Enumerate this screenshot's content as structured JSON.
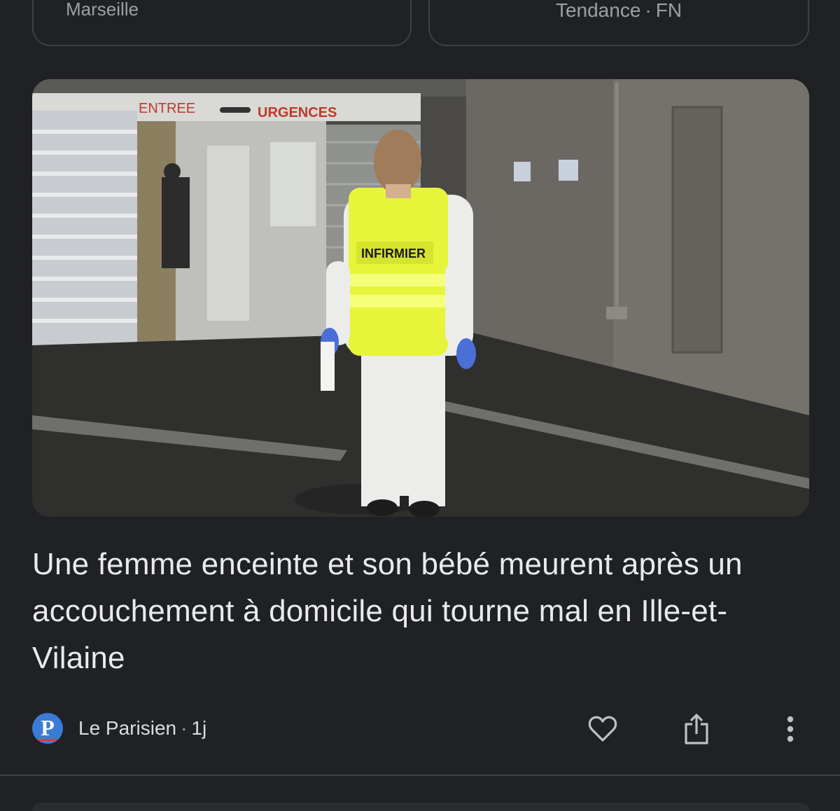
{
  "top_cards": {
    "left_text": "Marseille",
    "right_topic": "Tendance",
    "right_separator": "·",
    "right_source": "FN"
  },
  "article": {
    "headline": "Une femme enceinte et son bébé meurent après un accouchement à domicile qui tourne mal en Ille-et-Vilaine",
    "image_signs": {
      "entree": "ENTREE",
      "urgences": "URGENCES",
      "vest": "INFIRMIER"
    },
    "publisher": {
      "logo_letter": "P",
      "name": "Le Parisien",
      "separator": "·",
      "age": "1j"
    },
    "actions": {
      "like_icon": "heart-outline-icon",
      "share_icon": "share-icon",
      "more_icon": "more-vert-icon"
    }
  },
  "colors": {
    "background": "#202124",
    "text_primary": "#e8eaed",
    "text_secondary": "#9aa0a6",
    "border": "#3c4043",
    "publisher_blue": "#3b7bd6",
    "vest_yellow": "#e6f53a"
  }
}
